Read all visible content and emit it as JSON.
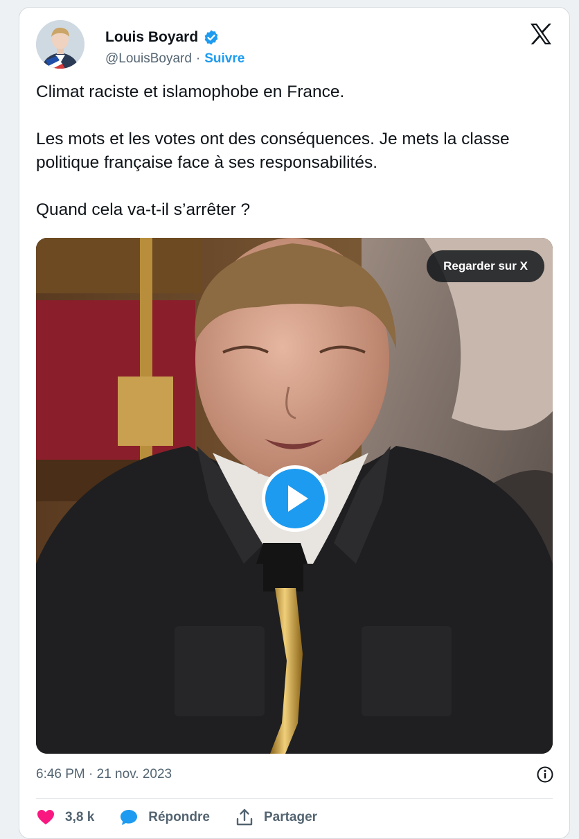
{
  "colors": {
    "accent": "#1d9bf0",
    "like": "#f91880",
    "text": "#0f1419",
    "muted": "#536471"
  },
  "author": {
    "name": "Louis Boyard",
    "handle": "@LouisBoyard",
    "separator": "·",
    "follow_label": "Suivre",
    "verified_icon": "verified-badge-icon",
    "avatar": "avatar-portrait"
  },
  "brand_icon": "x-logo-icon",
  "tweet": {
    "paragraphs": [
      "Climat raciste et islamophobe en France.",
      "Les mots et les votes ont des conséquences. Je mets la classe politique française face à ses responsabilités.",
      "Quand cela va-t-il s’arrêter ?"
    ]
  },
  "media": {
    "watch_label": "Regarder sur X",
    "play_icon": "play-icon"
  },
  "meta": {
    "timestamp": "6:46 PM · 21 nov. 2023",
    "info_icon": "info-icon"
  },
  "actions": {
    "like_count": "3,8 k",
    "reply_label": "Répondre",
    "share_label": "Partager",
    "like_icon": "heart-icon",
    "reply_icon": "speech-bubble-icon",
    "share_icon": "share-arrow-icon"
  }
}
